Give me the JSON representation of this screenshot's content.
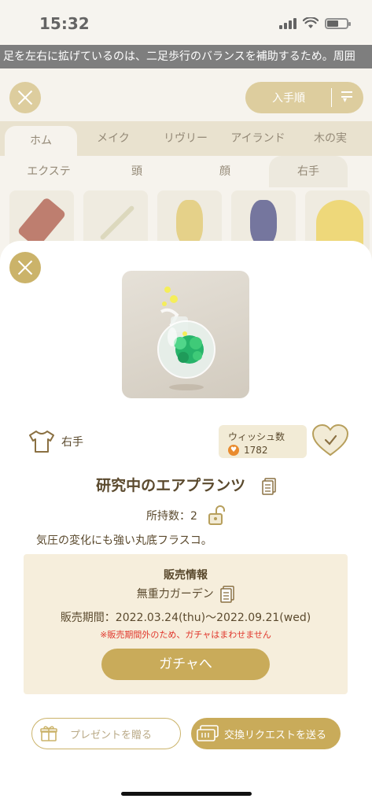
{
  "status_bar": {
    "time": "15:32"
  },
  "ticker": {
    "text": "足を左右に拡げているのは、二足歩行のバランスを補助するため。周囲"
  },
  "background": {
    "sort_label": "入手順",
    "category_tabs": [
      "ホム",
      "メイク",
      "リヴリー",
      "アイランド",
      "木の実"
    ],
    "active_category": "ホム",
    "sub_tabs": [
      "エクステ",
      "頭",
      "顔",
      "右手"
    ],
    "active_sub_tab": "右手"
  },
  "item": {
    "category_label": "右手",
    "wish_title": "ウィッシュ数",
    "wish_count": "1782",
    "name": "研究中のエアプランツ",
    "owned_text": "所持数：2",
    "description": "気圧の変化にも強い丸底フラスコ。"
  },
  "sales": {
    "heading": "販売情報",
    "shop_name": "無重力ガーデン",
    "period": "販売期間：2022.03.24(thu)〜2022.09.21(wed)",
    "warning": "※販売期間外のため、ガチャはまわせません",
    "gacha_button": "ガチャへ"
  },
  "actions": {
    "present_button": "プレゼントを贈る",
    "trade_button": "交換リクエストを送る"
  },
  "colors": {
    "gold": "#c9ab5a",
    "text_brown": "#5b4a2e",
    "warning_red": "#e0362b",
    "panel_beige": "#f6eedc"
  }
}
